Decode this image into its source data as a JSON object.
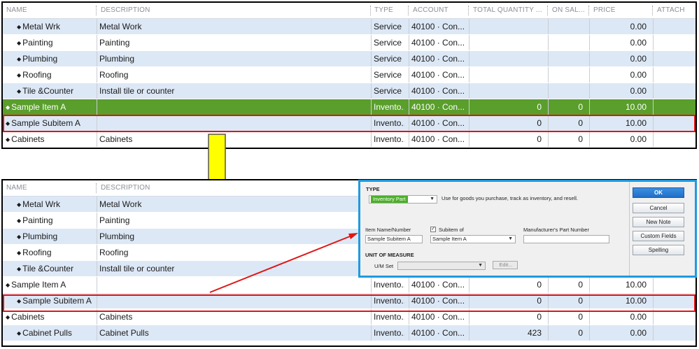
{
  "columns": {
    "name": "NAME",
    "description": "DESCRIPTION",
    "type": "TYPE",
    "account": "ACCOUNT",
    "total_quantity": "TOTAL QUANTITY ...",
    "on_sales": "ON SAL...",
    "price": "PRICE",
    "attach": "ATTACH"
  },
  "top_rows": [
    {
      "name": "Metal Wrk",
      "description": "Metal Work",
      "type": "Service",
      "account": "40100 · Con...",
      "qty": "",
      "on_sales": "",
      "price": "0.00",
      "indent": true
    },
    {
      "name": "Painting",
      "description": "Painting",
      "type": "Service",
      "account": "40100 · Con...",
      "qty": "",
      "on_sales": "",
      "price": "0.00",
      "indent": true
    },
    {
      "name": "Plumbing",
      "description": "Plumbing",
      "type": "Service",
      "account": "40100 · Con...",
      "qty": "",
      "on_sales": "",
      "price": "0.00",
      "indent": true
    },
    {
      "name": "Roofing",
      "description": "Roofing",
      "type": "Service",
      "account": "40100 · Con...",
      "qty": "",
      "on_sales": "",
      "price": "0.00",
      "indent": true
    },
    {
      "name": "Tile &Counter",
      "description": "Install tile or counter",
      "type": "Service",
      "account": "40100 · Con...",
      "qty": "",
      "on_sales": "",
      "price": "0.00",
      "indent": true
    },
    {
      "name": "Sample Item A",
      "description": "",
      "type": "Invento...",
      "account": "40100 · Con...",
      "qty": "0",
      "on_sales": "0",
      "price": "10.00",
      "indent": false
    },
    {
      "name": "Sample Subitem A",
      "description": "",
      "type": "Invento...",
      "account": "40100 · Con...",
      "qty": "0",
      "on_sales": "0",
      "price": "10.00",
      "indent": false
    },
    {
      "name": "Cabinets",
      "description": "Cabinets",
      "type": "Invento...",
      "account": "40100 · Con...",
      "qty": "0",
      "on_sales": "0",
      "price": "0.00",
      "indent": false
    }
  ],
  "bottom_rows": [
    {
      "name": "Metal Wrk",
      "description": "Metal Work",
      "type": "",
      "account": "",
      "qty": "",
      "on_sales": "",
      "price": "",
      "indent": true
    },
    {
      "name": "Painting",
      "description": "Painting",
      "type": "",
      "account": "",
      "qty": "",
      "on_sales": "",
      "price": "",
      "indent": true
    },
    {
      "name": "Plumbing",
      "description": "Plumbing",
      "type": "",
      "account": "",
      "qty": "",
      "on_sales": "",
      "price": "",
      "indent": true
    },
    {
      "name": "Roofing",
      "description": "Roofing",
      "type": "",
      "account": "",
      "qty": "",
      "on_sales": "",
      "price": "",
      "indent": true
    },
    {
      "name": "Tile &Counter",
      "description": "Install tile or counter",
      "type": "",
      "account": "",
      "qty": "",
      "on_sales": "",
      "price": "",
      "indent": true
    },
    {
      "name": "Sample Item A",
      "description": "",
      "type": "Invento...",
      "account": "40100 · Con...",
      "qty": "0",
      "on_sales": "0",
      "price": "10.00",
      "indent": false
    },
    {
      "name": "Sample Subitem A",
      "description": "",
      "type": "Invento...",
      "account": "40100 · Con...",
      "qty": "0",
      "on_sales": "0",
      "price": "10.00",
      "indent": true
    },
    {
      "name": "Cabinets",
      "description": "Cabinets",
      "type": "Invento...",
      "account": "40100 · Con...",
      "qty": "0",
      "on_sales": "0",
      "price": "0.00",
      "indent": false
    },
    {
      "name": "Cabinet Pulls",
      "description": "Cabinet Pulls",
      "type": "Invento...",
      "account": "40100 · Con...",
      "qty": "423",
      "on_sales": "0",
      "price": "0.00",
      "indent": true
    }
  ],
  "dialog": {
    "type_label": "TYPE",
    "type_value": "Inventory Part",
    "type_help": "Use for goods you purchase, track as inventory, and resell.",
    "item_name_label": "Item Name/Number",
    "item_name_value": "Sample Subitem A",
    "subitem_label": "Subitem of",
    "subitem_checked": "✓",
    "subitem_value": "Sample Item A",
    "mfr_label": "Manufacturer's Part Number",
    "mfr_value": "",
    "uom_label": "UNIT OF MEASURE",
    "um_set_label": "U/M Set",
    "um_set_value": "",
    "edit_label": "Edit...",
    "ok_label": "OK",
    "cancel_label": "Cancel",
    "new_note_label": "New Note",
    "custom_fields_label": "Custom Fields",
    "spelling_label": "Spelling"
  },
  "colors": {
    "selected_row": "#5a9e2c",
    "alt_row": "#dde8f6",
    "highlight": "#e01515",
    "arrow_yellow": "#ffff00",
    "dialog_border": "#1e9be0",
    "type_field": "#4caf2a"
  }
}
